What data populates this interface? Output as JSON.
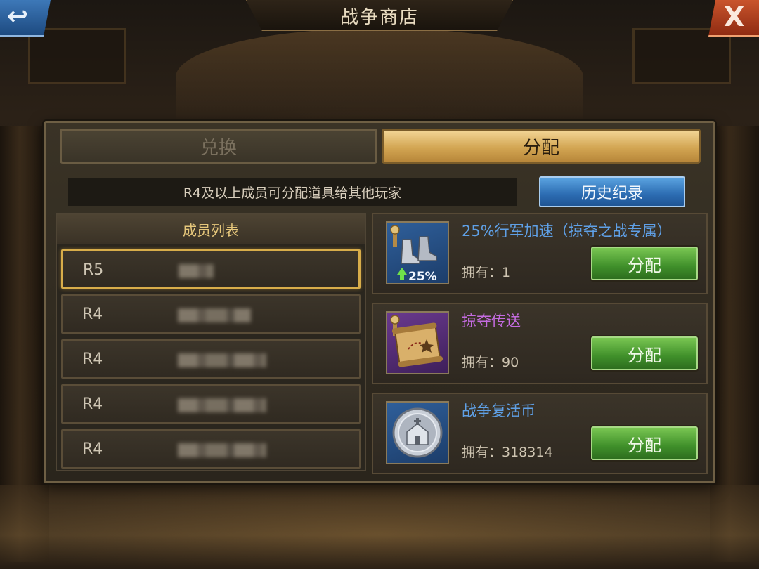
{
  "window": {
    "title": "战争商店"
  },
  "nav": {
    "back_glyph": "↩",
    "close_glyph": "X"
  },
  "tabs": [
    {
      "label": "兑换",
      "active": false
    },
    {
      "label": "分配",
      "active": true
    }
  ],
  "notice": "R4及以上成员可分配道具给其他玩家",
  "history_button": "历史纪录",
  "members": {
    "header": "成员列表",
    "rows": [
      {
        "rank": "R5",
        "name": "",
        "selected": true
      },
      {
        "rank": "R4",
        "name": "",
        "selected": false
      },
      {
        "rank": "R4",
        "name": "",
        "selected": false
      },
      {
        "rank": "R4",
        "name": "",
        "selected": false
      },
      {
        "rank": "R4",
        "name": "",
        "selected": false
      }
    ]
  },
  "items": [
    {
      "name": "25%行军加速（掠夺之战专属）",
      "owned": "拥有：1",
      "button": "分配",
      "icon": "march-speed-boots-icon",
      "badge": "25%",
      "name_color": "#5fa0e6"
    },
    {
      "name": "掠夺传送",
      "owned": "拥有：90",
      "button": "分配",
      "icon": "plunder-teleport-scroll-icon",
      "name_color": "#c46be0"
    },
    {
      "name": "战争复活币",
      "owned": "拥有：318314",
      "button": "分配",
      "icon": "war-revive-coin-icon",
      "name_color": "#5fa0e6"
    }
  ],
  "colors": {
    "accent_gold": "#d8ad4a",
    "history_blue": "#2c6cb2",
    "assign_green": "#3f8f2a"
  }
}
